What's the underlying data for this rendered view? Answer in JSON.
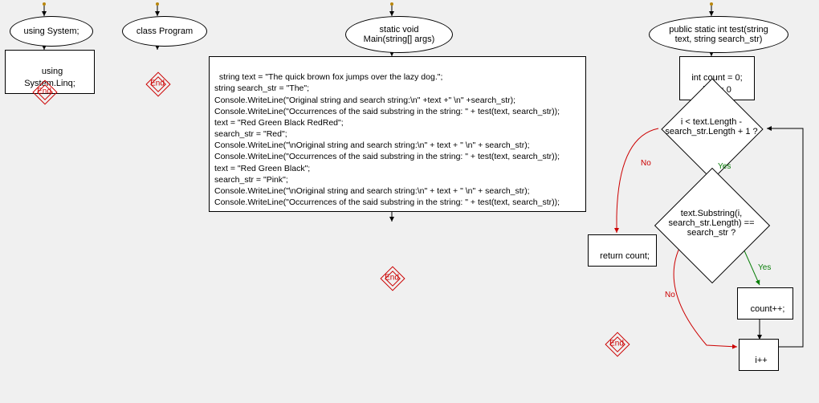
{
  "flowchart": {
    "columns": [
      {
        "start_arrow": true,
        "ellipse": "using System;",
        "rect": "using System.Linq;",
        "end": "End"
      },
      {
        "start_arrow": true,
        "ellipse": "class Program",
        "end": "End"
      },
      {
        "start_arrow": true,
        "ellipse": "static void\nMain(string[] args)",
        "rect": "string text = \"The quick brown fox jumps over the lazy dog.\";\nstring search_str = \"The\";\nConsole.WriteLine(\"Original string and search string:\\n\" +text +\" \\n\" +search_str);\nConsole.WriteLine(\"Occurrences of the said substring in the string: \" + test(text, search_str));\ntext = \"Red Green Black RedRed\";\nsearch_str = \"Red\";\nConsole.WriteLine(\"\\nOriginal string and search string:\\n\" + text + \" \\n\" + search_str);\nConsole.WriteLine(\"Occurrences of the said substring in the string: \" + test(text, search_str));\ntext = \"Red Green Black\";\nsearch_str = \"Pink\";\nConsole.WriteLine(\"\\nOriginal string and search string:\\n\" + text + \" \\n\" + search_str);\nConsole.WriteLine(\"Occurrences of the said substring in the string: \" + test(text, search_str));",
        "end": "End"
      },
      {
        "start_arrow": true,
        "ellipse": "public static int test(string\ntext, string search_str)",
        "init_rect": "int count = 0;\nint i = 0",
        "decision1": "i < text.Length -\nsearch_str.Length + 1 ?",
        "decision1_yes": "Yes",
        "decision1_no": "No",
        "return_rect": "return count;",
        "end": "End",
        "decision2": "text.Substring(i,\nsearch_str.Length) ==\nsearch_str ?",
        "decision2_yes": "Yes",
        "decision2_no": "No",
        "count_rect": "count++;",
        "incr_rect": "i++"
      }
    ]
  }
}
